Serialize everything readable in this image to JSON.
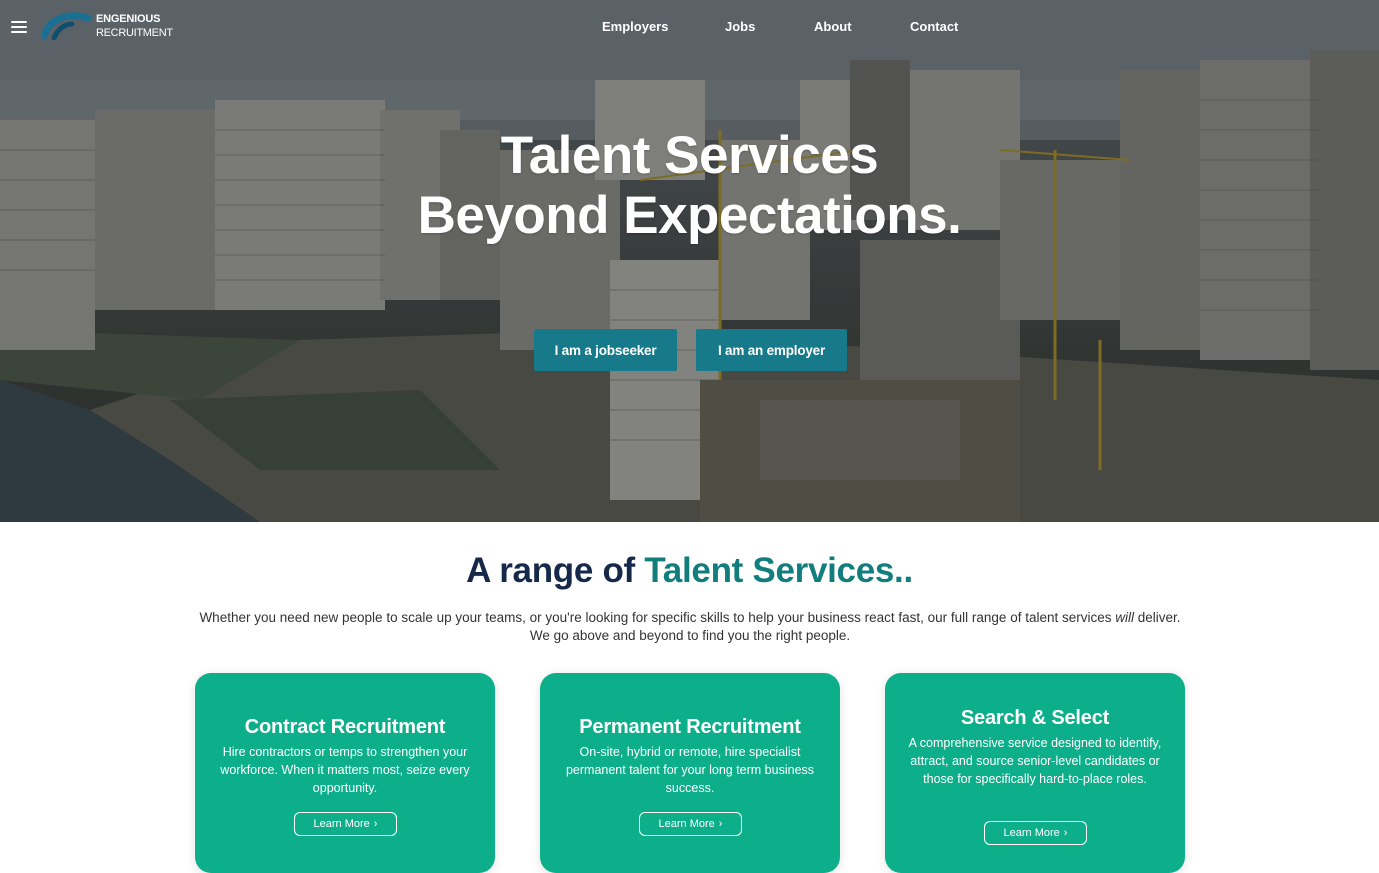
{
  "header": {
    "logo_line1": "ENGENIOUS",
    "logo_line2": "RECRUITMENT",
    "nav": [
      {
        "label": "Employers"
      },
      {
        "label": "Jobs"
      },
      {
        "label": "About"
      },
      {
        "label": "Contact"
      }
    ]
  },
  "hero": {
    "title_line1": "Talent Services",
    "title_line2": "Beyond Expectations.",
    "buttons": [
      {
        "label": "I am a jobseeker"
      },
      {
        "label": "I am an employer"
      }
    ]
  },
  "services": {
    "title_part1": "A range of",
    "title_part2": "Talent Services..",
    "desc_before": "Whether you need new people to scale up your teams, or you're looking for specific skills to help your business react fast, our full range of talent services",
    "desc_em": "will",
    "desc_after": "deliver.",
    "desc_line2": "We go above and beyond to find you the right people.",
    "cards": [
      {
        "title": "Contract Recruitment",
        "text": "Hire contractors or temps to strengthen your workforce. When it matters most, seize every opportunity.",
        "button": "Learn More"
      },
      {
        "title": "Permanent Recruitment",
        "text": "On-site, hybrid or remote, hire specialist permanent talent for your long term business success.",
        "button": "Learn More"
      },
      {
        "title": "Search & Select",
        "text": "A comprehensive service designed to identify, attract, and source senior-level candidates or those for specifically hard-to-place roles.",
        "button": "Learn More"
      }
    ]
  },
  "colors": {
    "brand_teal": "#127d7d",
    "navy": "#16294a",
    "button_blue": "#177a8b",
    "card_green": "#0daf8a"
  },
  "icons": {
    "menu": "hamburger-menu-icon",
    "logo": "arc-logo-icon",
    "arrow": "chevron-right-icon"
  }
}
